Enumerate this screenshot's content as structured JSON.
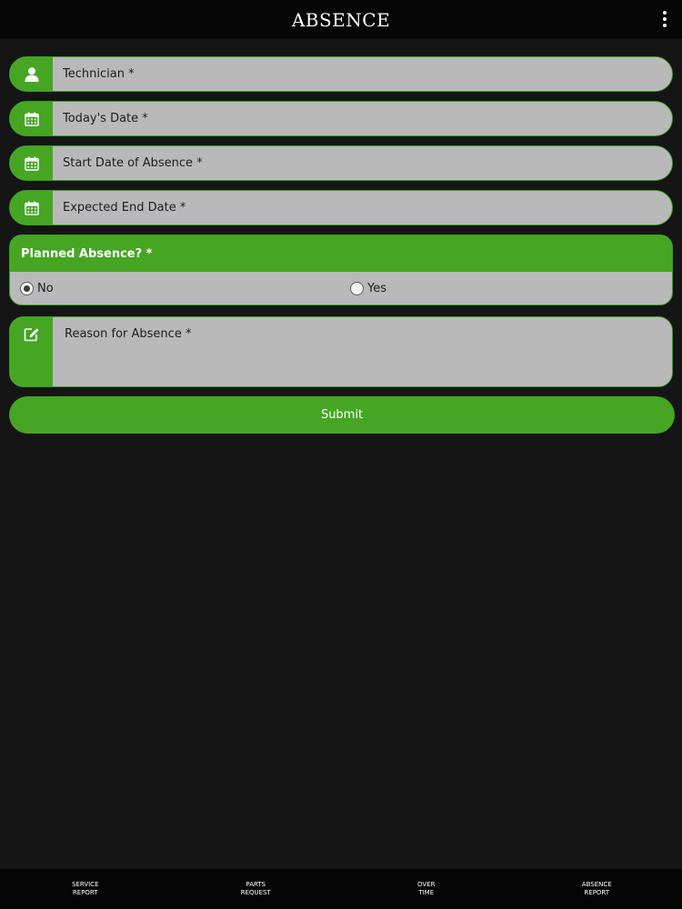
{
  "header": {
    "title": "ABSENCE",
    "menu_icon": "vertical-dots-icon"
  },
  "form": {
    "fields": [
      {
        "icon": "user-icon",
        "placeholder": "Technician *",
        "value": ""
      },
      {
        "icon": "calendar-icon",
        "placeholder": "Today's Date *",
        "value": ""
      },
      {
        "icon": "calendar-icon",
        "placeholder": "Start Date of Absence *",
        "value": ""
      },
      {
        "icon": "calendar-icon",
        "placeholder": "Expected End Date *",
        "value": ""
      }
    ],
    "planned": {
      "label": "Planned Absence? *",
      "options": [
        {
          "label": "No",
          "checked": true
        },
        {
          "label": "Yes",
          "checked": false
        }
      ]
    },
    "reason": {
      "icon": "edit-icon",
      "placeholder": "Reason for Absence *",
      "value": ""
    },
    "submit_label": "Submit"
  },
  "nav": {
    "items": [
      {
        "label": "SERVICE\nREPORT"
      },
      {
        "label": "PARTS\nREQUEST"
      },
      {
        "label": "OVER\nTIME"
      },
      {
        "label": "ABSENCE\nREPORT"
      }
    ]
  },
  "colors": {
    "accent": "#46a523",
    "field_bg": "#b9b9b9",
    "background": "#151515",
    "bar": "#050505"
  }
}
